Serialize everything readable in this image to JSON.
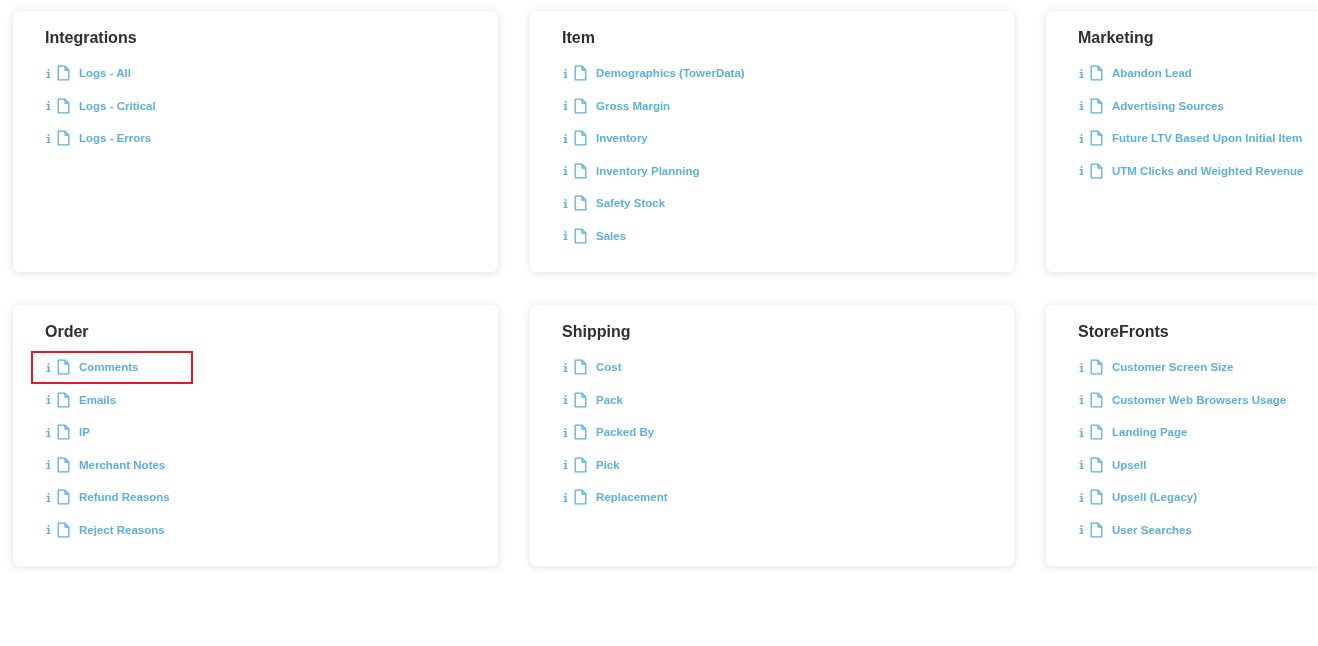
{
  "sections": [
    {
      "title": "Integrations",
      "reports": [
        {
          "label": "Logs - All",
          "highlighted": false
        },
        {
          "label": "Logs - Critical",
          "highlighted": false
        },
        {
          "label": "Logs - Errors",
          "highlighted": false
        }
      ]
    },
    {
      "title": "Item",
      "reports": [
        {
          "label": "Demographics (TowerData)",
          "highlighted": false
        },
        {
          "label": "Gross Margin",
          "highlighted": false
        },
        {
          "label": "Inventory",
          "highlighted": false
        },
        {
          "label": "Inventory Planning",
          "highlighted": false
        },
        {
          "label": "Safety Stock",
          "highlighted": false
        },
        {
          "label": "Sales",
          "highlighted": false
        }
      ]
    },
    {
      "title": "Marketing",
      "reports": [
        {
          "label": "Abandon Lead",
          "highlighted": false
        },
        {
          "label": "Advertising Sources",
          "highlighted": false
        },
        {
          "label": "Future LTV Based Upon Initial Item",
          "highlighted": false
        },
        {
          "label": "UTM Clicks and Weighted Revenue",
          "highlighted": false
        }
      ]
    },
    {
      "title": "Order",
      "reports": [
        {
          "label": "Comments",
          "highlighted": true
        },
        {
          "label": "Emails",
          "highlighted": false
        },
        {
          "label": "IP",
          "highlighted": false
        },
        {
          "label": "Merchant Notes",
          "highlighted": false
        },
        {
          "label": "Refund Reasons",
          "highlighted": false
        },
        {
          "label": "Reject Reasons",
          "highlighted": false
        }
      ]
    },
    {
      "title": "Shipping",
      "reports": [
        {
          "label": "Cost",
          "highlighted": false
        },
        {
          "label": "Pack",
          "highlighted": false
        },
        {
          "label": "Packed By",
          "highlighted": false
        },
        {
          "label": "Pick",
          "highlighted": false
        },
        {
          "label": "Replacement",
          "highlighted": false
        }
      ]
    },
    {
      "title": "StoreFronts",
      "reports": [
        {
          "label": "Customer Screen Size",
          "highlighted": false
        },
        {
          "label": "Customer Web Browsers Usage",
          "highlighted": false
        },
        {
          "label": "Landing Page",
          "highlighted": false
        },
        {
          "label": "Upsell",
          "highlighted": false
        },
        {
          "label": "Upsell (Legacy)",
          "highlighted": false
        },
        {
          "label": "User Searches",
          "highlighted": false
        }
      ]
    }
  ]
}
